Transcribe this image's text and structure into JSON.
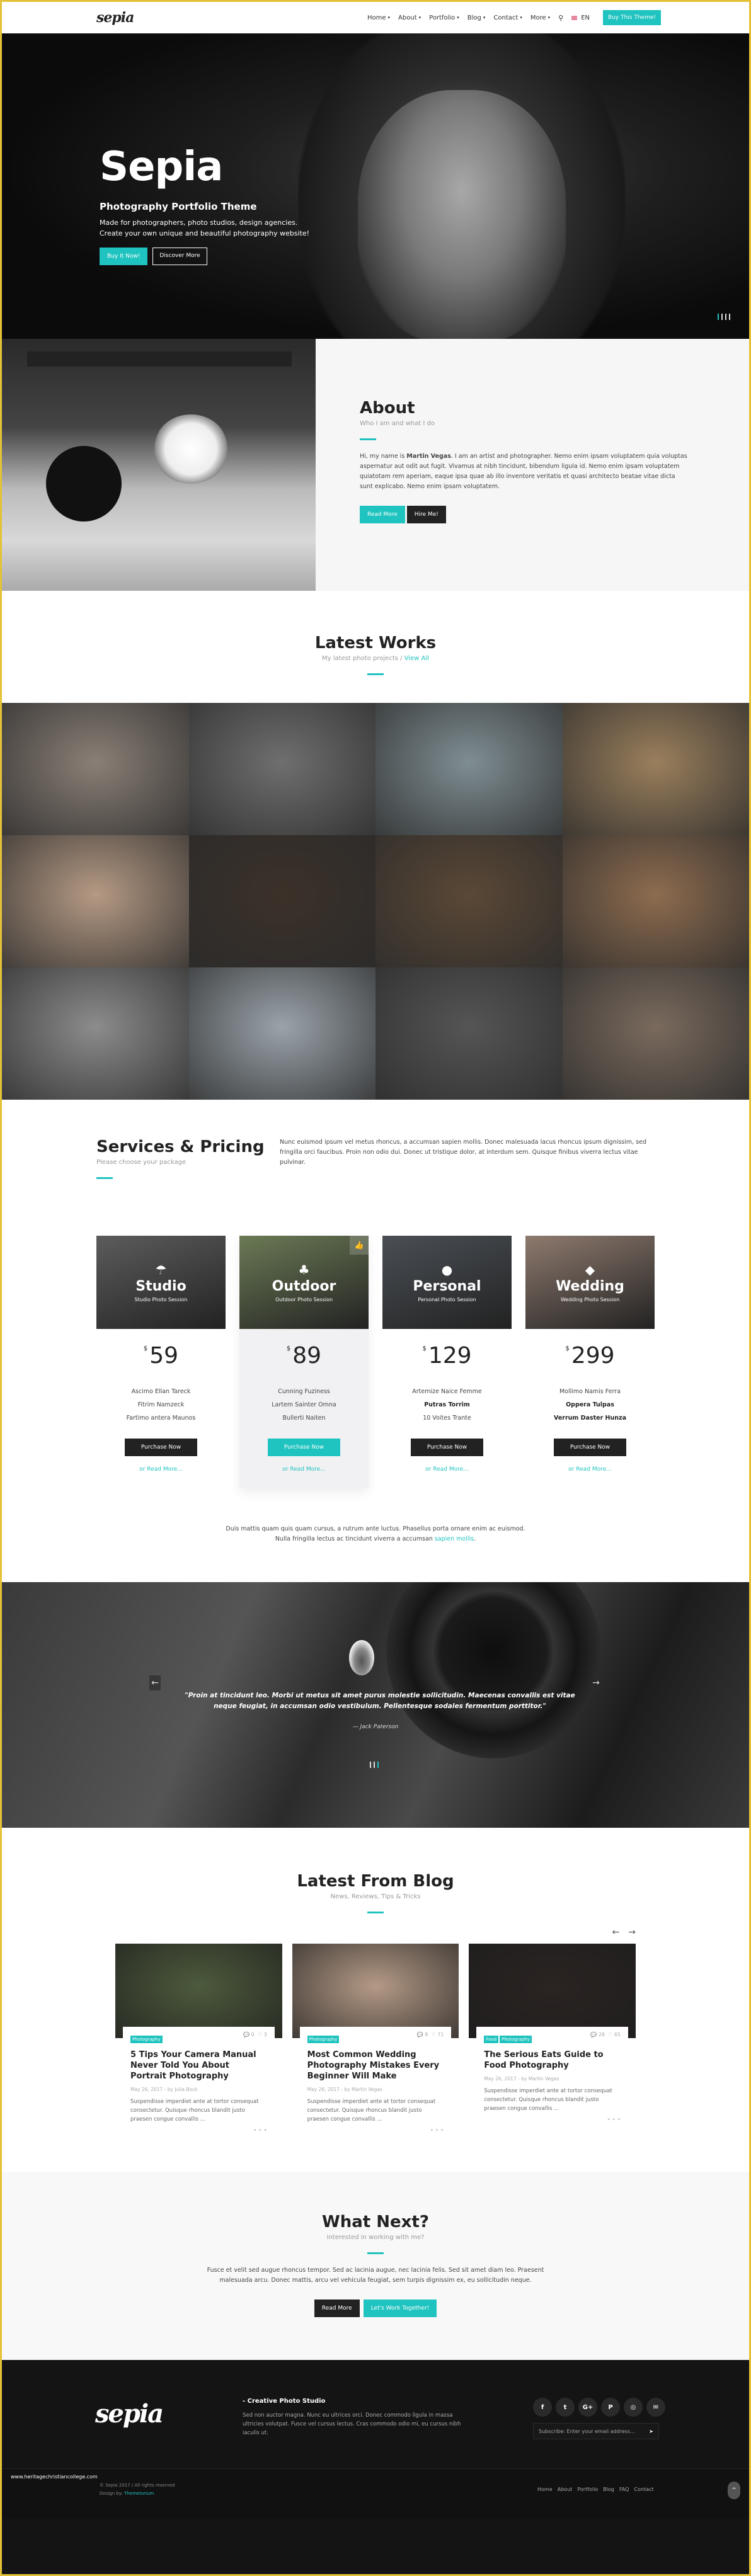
{
  "header": {
    "logo": "sepia",
    "nav": [
      {
        "label": "Home"
      },
      {
        "label": "About"
      },
      {
        "label": "Portfolio"
      },
      {
        "label": "Blog"
      },
      {
        "label": "Contact"
      },
      {
        "label": "More"
      }
    ],
    "search_icon": "search-icon",
    "language": "EN",
    "buy_label": "Buy This Theme!"
  },
  "hero": {
    "title": "Sepia",
    "subtitle": "Photography Portfolio Theme",
    "desc_line1": "Made for photographers, photo studios, design agencies.",
    "desc_line2": "Create your own unique and beautiful photography website!",
    "primary_btn": "Buy It Now!",
    "secondary_btn": "Discover More",
    "slides_total": 4,
    "active_slide": 1
  },
  "about": {
    "title": "About",
    "subtitle": "Who I am and what I do",
    "body_pre": "Hi, my name is ",
    "body_name": "Martin Vegas",
    "body_post": ". I am an artist and photographer. Nemo enim ipsam voluptatem quia voluptas aspernatur aut odit aut fugit. Vivamus at nibh tincidunt, bibendum ligula id. Nemo enim ipsam voluptatem quiatotam rem aperiam, eaque ipsa quae ab illo inventore veritatis et quasi architecto beatae vitae dicta sunt explicabo. Nemo enim ipsam voluptatem.",
    "read_more": "Read More",
    "hire_me": "Hire Me!"
  },
  "works": {
    "title": "Latest Works",
    "subtitle": "My latest photo projects / ",
    "view_all": "View All",
    "tiles": [
      {
        "color": "#8a7f76"
      },
      {
        "color": "#6f6f6f"
      },
      {
        "color": "#7f8e93"
      },
      {
        "color": "#9a7f5c"
      },
      {
        "color": "#b59a84"
      },
      {
        "color": "#3b3129"
      },
      {
        "color": "#5a4836"
      },
      {
        "color": "#8d6c4f"
      },
      {
        "color": "#8c8c8c"
      },
      {
        "color": "#9aa3aa"
      },
      {
        "color": "#555555"
      },
      {
        "color": "#7a6a5d"
      }
    ]
  },
  "services": {
    "title": "Services & Pricing",
    "subtitle": "Please choose your package",
    "description": "Nunc euismod ipsum vel metus rhoncus, a accumsan sapien mollis. Donec malesuada lacus rhoncus ipsum dignissim, sed fringilla orci faucibus. Proin non odio dui. Donec ut tristique dolor, at interdum sem. Quisque finibus viverra lectus vitae pulvinar.",
    "plans": [
      {
        "name": "Studio",
        "session": "Studio Photo Session",
        "icon": "☂",
        "currency": "$",
        "price": "59",
        "features": [
          "Ascimo Ellan Tareck",
          "Fitrim Namzeck",
          "Fartimo antera Maunos"
        ],
        "button": "Purchase Now",
        "more": "or Read More...",
        "bg": "#5c5c5c"
      },
      {
        "name": "Outdoor",
        "session": "Outdoor Photo Session",
        "icon": "♣",
        "currency": "$",
        "price": "89",
        "features": [
          "Cunning Fuziness",
          "Lartem Sainter Omna",
          "Bullerti Naiten"
        ],
        "button": "Purchase Now",
        "more": "or Read More...",
        "bg": "#6b7a55"
      },
      {
        "name": "Personal",
        "session": "Personal Photo Session",
        "icon": "●",
        "currency": "$",
        "price": "129",
        "features": [
          "Artemize Naice Femme",
          "Putras Torrim",
          "10 Voites Trante"
        ],
        "button": "Purchase Now",
        "more": "or Read More...",
        "bg": "#4a4f55"
      },
      {
        "name": "Wedding",
        "session": "Wedding Photo Session",
        "icon": "◆",
        "currency": "$",
        "price": "299",
        "features": [
          "Mollimo Namis Ferra",
          "Oppera Tulpas",
          "Verrum Daster Hunza"
        ],
        "button": "Purchase Now",
        "more": "or Read More...",
        "bg": "#8e7a6e"
      }
    ],
    "note_pre": "Duis mattis quam quis quam cursus, a rutrum ante luctus. Phasellus porta ornare enim ac euismod. Nulla fringilla lectus ac tincidunt viverra a accumsan ",
    "note_link": "sapien mollis",
    "note_post": "."
  },
  "testimonial": {
    "quote": "\"Proin at tincidunt leo. Morbi ut metus sit amet purus molestie sollicitudin. Maecenas convallis est vitae neque feugiat, in accumsan odio vestibulum. Pellentesque sodales fermentum porttitor.\"",
    "author": "— Jack Paterson",
    "prev": "←",
    "next": "→"
  },
  "blog": {
    "title": "Latest From Blog",
    "subtitle": "News, Reviews, Tips & Tricks",
    "prev": "←",
    "next": "→",
    "posts": [
      {
        "tags": [
          "Photography"
        ],
        "comments": "0",
        "likes": "3",
        "title": "5 Tips Your Camera Manual Never Told You About Portrait Photography",
        "date": "May 26, 2017 - by Julia Bock",
        "excerpt": "Suspendisse imperdiet ante at tortor consequat consectetur. Quisque rhoncus blandit justo praesen congue convallis ...",
        "bg": "#4d5a3c"
      },
      {
        "tags": [
          "Photography"
        ],
        "comments": "8",
        "likes": "71",
        "title": "Most Common Wedding Photography Mistakes Every Beginner Will Make",
        "date": "May 26, 2017 - by Martin Vegas",
        "excerpt": "Suspendisse imperdiet ante at tortor consequat consectetur. Quisque rhoncus blandit justo praesen congue convallis ...",
        "bg": "#b49a86"
      },
      {
        "tags": [
          "Food",
          "Photography"
        ],
        "comments": "28",
        "likes": "65",
        "title": "The Serious Eats Guide to Food Photography",
        "date": "May 26, 2017 - by Martin Vegas",
        "excerpt": "Suspendisse imperdiet ante at tortor consequat consectetur. Quisque rhoncus blandit justo praesen congue convallis ...",
        "bg": "#2a2422"
      }
    ]
  },
  "next": {
    "title": "What Next?",
    "subtitle": "Interested in working with me?",
    "body": "Fusce et velit sed augue rhoncus tempor. Sed ac lacinia augue, nec lacinia felis. Sed sit amet diam leo. Praesent malesuada arcu. Donec mattis, arcu vel vehicula feugiat, sem turpis dignissim ex, eu sollicitudin neque.",
    "read_more": "Read More",
    "work_together": "Let's Work Together!"
  },
  "footer": {
    "logo": "sepia",
    "title": "- Creative Photo Studio",
    "body": "Sed non auctor magna. Nunc eu ultrices orci. Donec commodo ligula in massa ultricies volutpat. Fusce vel cursus lectus. Cras commodo odio mi, eu cursus nibh iaculis ut.",
    "social": [
      {
        "icon": "f",
        "name": "facebook-icon"
      },
      {
        "icon": "t",
        "name": "twitter-icon"
      },
      {
        "icon": "G+",
        "name": "google-plus-icon"
      },
      {
        "icon": "P",
        "name": "pinterest-icon"
      },
      {
        "icon": "◎",
        "name": "dribbble-icon"
      },
      {
        "icon": "✉",
        "name": "mail-icon"
      }
    ],
    "subscribe_placeholder": "Subscribe: Enter your email address...",
    "copyright": "© Sepia 2017 / All rights reserved",
    "design_by": "Design by: ",
    "designer": "Themetorium",
    "links": [
      "Home",
      "About",
      "Portfolio",
      "Blog",
      "FAQ",
      "Contact"
    ],
    "watermark": "www.heritagechristiancollege.com",
    "back_to_top": "^"
  }
}
